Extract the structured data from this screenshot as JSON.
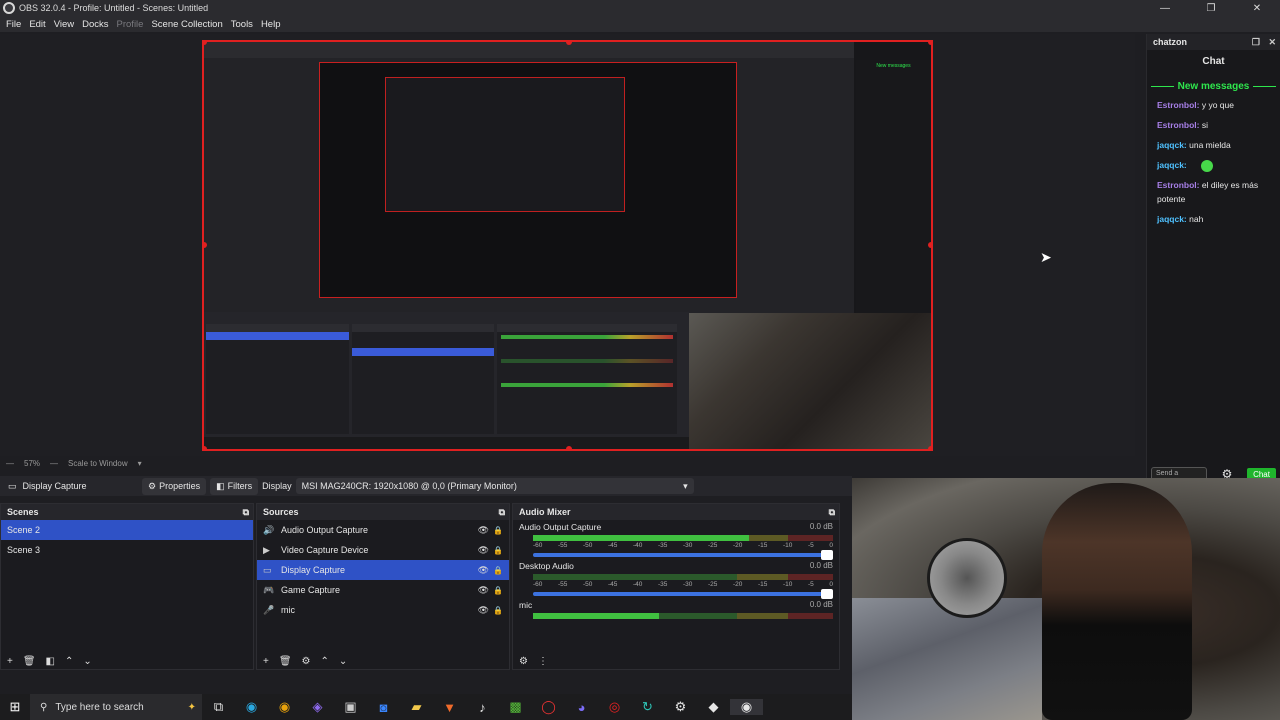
{
  "window": {
    "title": "OBS 32.0.4 - Profile: Untitled - Scenes: Untitled",
    "controls": [
      "—",
      "❐",
      "✕"
    ]
  },
  "menu": [
    "File",
    "Edit",
    "View",
    "Docks",
    "Profile",
    "Scene Collection",
    "Tools",
    "Help"
  ],
  "zoombar": {
    "zoom": "57%",
    "scale_label": "Scale to Window"
  },
  "chat": {
    "dock_title": "chatzon",
    "title": "Chat",
    "new_messages": "New messages",
    "messages": [
      {
        "user": "Estronbol:",
        "text": " y yo que",
        "color": "#a77fe8"
      },
      {
        "user": "Estronbol:",
        "text": " si",
        "color": "#a77fe8"
      },
      {
        "user": "jaqqck:",
        "text": " una mielda",
        "color": "#4fc1ff"
      },
      {
        "user": "jaqqck:",
        "text": "",
        "color": "#4fc1ff",
        "emote": true
      },
      {
        "user": "Estronbol:",
        "text": " el diley es más potente",
        "color": "#a77fe8"
      },
      {
        "user": "jaqqck:",
        "text": " nah",
        "color": "#4fc1ff"
      }
    ],
    "input_placeholder": "Send a",
    "send_label": "Chat"
  },
  "context": {
    "source_name": "Display Capture",
    "properties": "Properties",
    "filters": "Filters",
    "display_label": "Display",
    "display_value": "MSI MAG240CR: 1920x1080 @ 0,0 (Primary Monitor)"
  },
  "scenes": {
    "title": "Scenes",
    "items": [
      "Scene 2",
      "Scene 3"
    ],
    "selected": 0
  },
  "sources": {
    "title": "Sources",
    "items": [
      {
        "label": "Audio Output Capture",
        "icon": "speaker-icon"
      },
      {
        "label": "Video Capture Device",
        "icon": "camera-icon"
      },
      {
        "label": "Display Capture",
        "icon": "monitor-icon"
      },
      {
        "label": "Game Capture",
        "icon": "gamepad-icon"
      },
      {
        "label": "mic",
        "icon": "microphone-icon"
      }
    ],
    "selected": 2
  },
  "mixer": {
    "title": "Audio Mixer",
    "channels": [
      {
        "name": "Audio Output Capture",
        "db": "0.0 dB",
        "level": 0.72
      },
      {
        "name": "Desktop Audio",
        "db": "0.0 dB",
        "level": 0.0
      },
      {
        "name": "mic",
        "db": "0.0 dB",
        "level": 0.42
      }
    ],
    "ticks": [
      "-60",
      "-55",
      "-50",
      "-45",
      "-40",
      "-35",
      "-30",
      "-25",
      "-20",
      "-15",
      "-10",
      "-5",
      "0"
    ]
  },
  "taskbar": {
    "search_placeholder": "Type here to search"
  },
  "inner": {
    "chat_new": "New messages"
  }
}
